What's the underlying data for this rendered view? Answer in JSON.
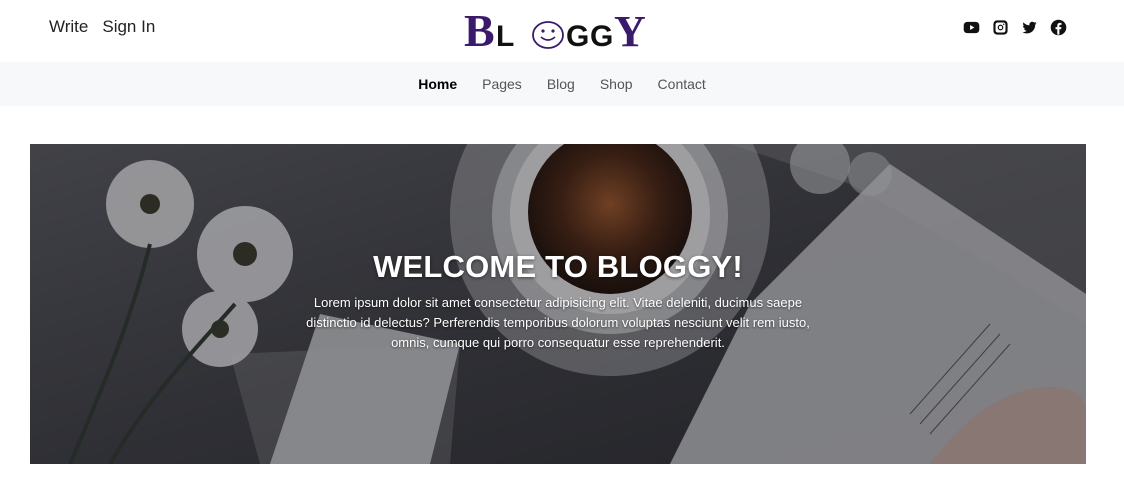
{
  "header": {
    "links": [
      {
        "label": "Write"
      },
      {
        "label": "Sign In"
      }
    ],
    "logo_text": "BLOGGY",
    "socials": [
      {
        "icon": "youtube-icon"
      },
      {
        "icon": "instagram-icon"
      },
      {
        "icon": "twitter-icon"
      },
      {
        "icon": "facebook-icon"
      }
    ]
  },
  "nav": {
    "items": [
      {
        "label": "Home",
        "active": true
      },
      {
        "label": "Pages"
      },
      {
        "label": "Blog"
      },
      {
        "label": "Shop"
      },
      {
        "label": "Contact"
      }
    ]
  },
  "hero": {
    "title": "WELCOME TO BLOGGY!",
    "text": "Lorem ipsum dolor sit amet consectetur adipisicing elit. Vitae deleniti, ducimus saepe distinctio id delectus? Perferendis temporibus dolorum voluptas nesciunt velit rem iusto, omnis, cumque qui porro consequatur esse reprehenderit."
  },
  "colors": {
    "logo_purple": "#3a1a6b",
    "nav_bg": "#f7f8f9"
  }
}
